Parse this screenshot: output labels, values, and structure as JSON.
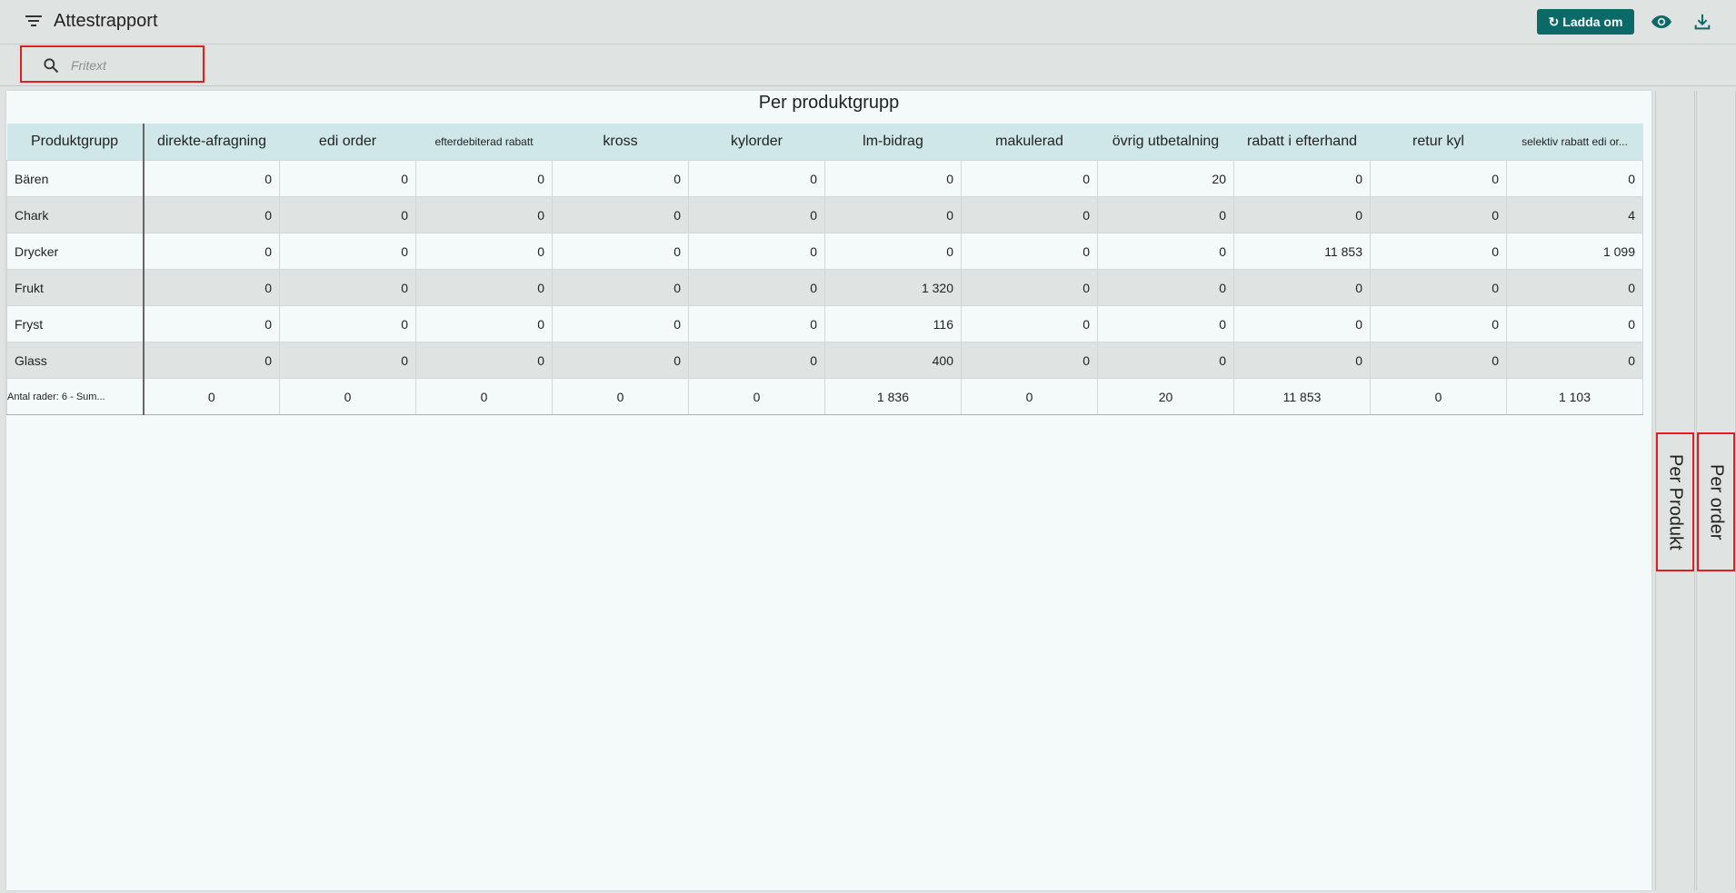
{
  "header": {
    "title": "Attestrapport",
    "reload_label": "Ladda om",
    "reload_icon": "refresh-icon",
    "view_icon": "eye-icon",
    "download_icon": "download-icon"
  },
  "search": {
    "placeholder": "Fritext",
    "value": ""
  },
  "report": {
    "title": "Per produktgrupp",
    "columns": [
      "Produktgrupp",
      "direkte-afragning",
      "edi order",
      "efterdebiterad rabatt",
      "kross",
      "kylorder",
      "lm-bidrag",
      "makulerad",
      "övrig utbetalning",
      "rabatt i efterhand",
      "retur kyl",
      "selektiv rabatt edi or..."
    ],
    "rows": [
      {
        "name": "Bären",
        "values": [
          "0",
          "0",
          "0",
          "0",
          "0",
          "0",
          "0",
          "20",
          "0",
          "0",
          "0"
        ]
      },
      {
        "name": "Chark",
        "values": [
          "0",
          "0",
          "0",
          "0",
          "0",
          "0",
          "0",
          "0",
          "0",
          "0",
          "4"
        ]
      },
      {
        "name": "Drycker",
        "values": [
          "0",
          "0",
          "0",
          "0",
          "0",
          "0",
          "0",
          "0",
          "11 853",
          "0",
          "1 099"
        ]
      },
      {
        "name": "Frukt",
        "values": [
          "0",
          "0",
          "0",
          "0",
          "0",
          "1 320",
          "0",
          "0",
          "0",
          "0",
          "0"
        ]
      },
      {
        "name": "Fryst",
        "values": [
          "0",
          "0",
          "0",
          "0",
          "0",
          "116",
          "0",
          "0",
          "0",
          "0",
          "0"
        ]
      },
      {
        "name": "Glass",
        "values": [
          "0",
          "0",
          "0",
          "0",
          "0",
          "400",
          "0",
          "0",
          "0",
          "0",
          "0"
        ]
      }
    ],
    "footer": {
      "label": "Antal rader: 6   -   Sum...",
      "values": [
        "0",
        "0",
        "0",
        "0",
        "0",
        "1 836",
        "0",
        "20",
        "11 853",
        "0",
        "1 103"
      ]
    }
  },
  "side_tabs": [
    {
      "label": "Per Produkt"
    },
    {
      "label": "Per order"
    }
  ]
}
